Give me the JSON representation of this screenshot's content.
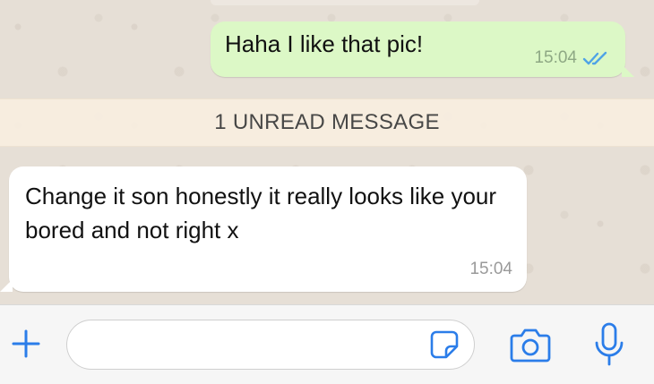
{
  "messages": {
    "outgoing": {
      "text": "Haha I like that pic!",
      "time": "15:04",
      "status": "read"
    },
    "incoming": {
      "text": "Change it son honestly it really looks like your bored and not right x",
      "time": "15:04"
    }
  },
  "unread_banner": {
    "text": "1 UNREAD MESSAGE"
  },
  "composer": {
    "input_value": "",
    "icons": {
      "attach": "plus-icon",
      "sticker": "sticker-icon",
      "camera": "camera-icon",
      "mic": "microphone-icon"
    }
  },
  "colors": {
    "outgoing_bubble": "#dcf8c6",
    "incoming_bubble": "#ffffff",
    "accent": "#2b7de9",
    "read_ticks": "#4fa3e6",
    "unread_bar": "#f8eee0"
  }
}
